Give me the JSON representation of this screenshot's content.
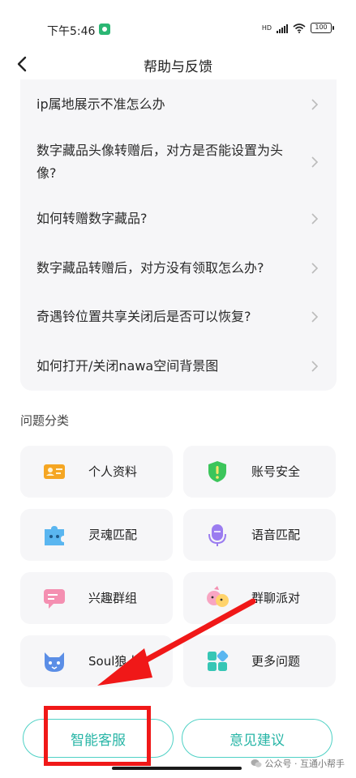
{
  "status_bar": {
    "time": "下午5:46",
    "hd": "HD",
    "battery": "100"
  },
  "header": {
    "title": "帮助与反馈"
  },
  "faq": [
    {
      "text": "ip属地展示不准怎么办"
    },
    {
      "text": "数字藏品头像转赠后，对方是否能设置为头像?"
    },
    {
      "text": "如何转赠数字藏品?"
    },
    {
      "text": "数字藏品转赠后，对方没有领取怎么办?"
    },
    {
      "text": "奇遇铃位置共享关闭后是否可以恢复?"
    },
    {
      "text": "如何打开/关闭nawa空间背景图"
    }
  ],
  "categories_title": "问题分类",
  "categories": [
    {
      "label": "个人资料",
      "icon": "id-card-icon"
    },
    {
      "label": "账号安全",
      "icon": "shield-icon"
    },
    {
      "label": "灵魂匹配",
      "icon": "puzzle-icon"
    },
    {
      "label": "语音匹配",
      "icon": "microphone-icon"
    },
    {
      "label": "兴趣群组",
      "icon": "chat-bubble-icon"
    },
    {
      "label": "群聊派对",
      "icon": "party-icon"
    },
    {
      "label": "Soul狼人",
      "icon": "wolf-icon"
    },
    {
      "label": "更多问题",
      "icon": "grid-icon"
    }
  ],
  "buttons": {
    "smart_service": "智能客服",
    "feedback": "意见建议"
  },
  "watermark": "公众号 · 互通小帮手",
  "colors": {
    "accent": "#27b5a6",
    "annotation": "#f01818"
  }
}
